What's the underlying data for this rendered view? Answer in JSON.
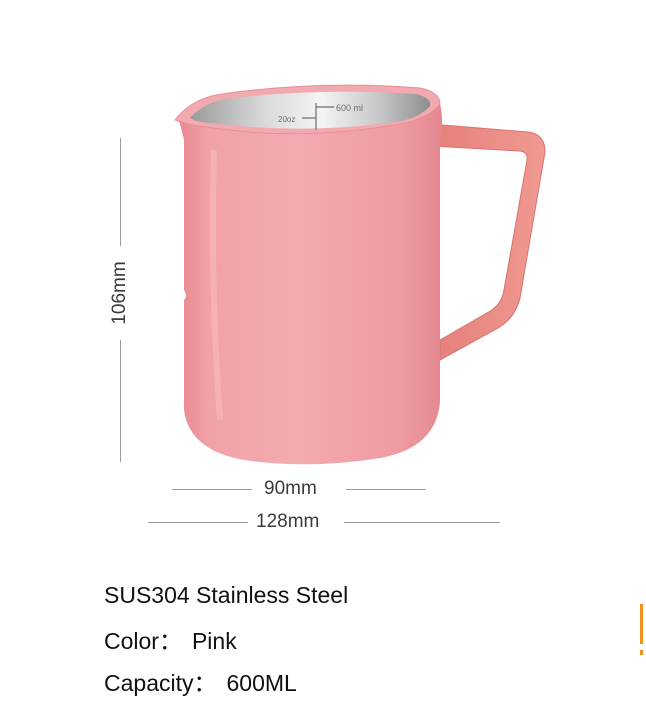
{
  "product": {
    "name": "Pink stainless steel milk frothing pitcher",
    "accent_color": "#ef8a8f",
    "handle_color": "#ec8f8a",
    "inner_color": "#bfbfbf"
  },
  "engraving": {
    "oz_mark": "20oz",
    "ml_mark": "600 ml"
  },
  "dimensions": {
    "height": "106mm",
    "body_width": "90mm",
    "overall_width": "128mm"
  },
  "specs": {
    "material": "SUS304 Stainless Steel",
    "color_label": "Color：",
    "color_value": "Pink",
    "capacity_label": "Capacity：",
    "capacity_value": "600ML"
  },
  "colors": {
    "dimension_line": "#9a9a9a",
    "accent_bar": "#f0901e"
  }
}
